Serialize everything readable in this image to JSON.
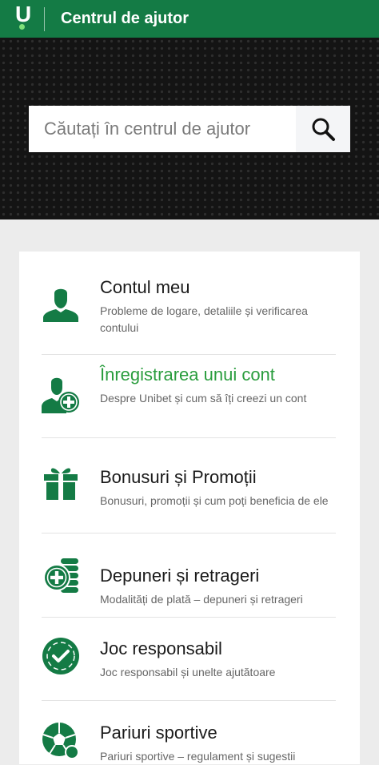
{
  "header": {
    "title": "Centrul de ajutor",
    "logo_letter": "U"
  },
  "search": {
    "placeholder": "Căutați în centrul de ajutor"
  },
  "colors": {
    "brand_green": "#147b45",
    "highlight_green": "#2a9d3e",
    "icon_green": "#147b45"
  },
  "categories": [
    {
      "title": "Contul meu",
      "description": "Probleme de logare, detaliile și verificarea contului",
      "icon": "user-icon",
      "highlighted": false
    },
    {
      "title": "Înregistrarea unui cont",
      "description": "Despre Unibet și cum să îți creezi un cont",
      "icon": "user-add-icon",
      "highlighted": true
    },
    {
      "title": "Bonusuri și Promoții",
      "description": "Bonusuri, promoții și cum poți beneficia de ele",
      "icon": "gift-icon",
      "highlighted": false
    },
    {
      "title": "Depuneri și retrageri",
      "description": "Modalități de plată – depuneri și retrageri",
      "icon": "coins-plus-icon",
      "highlighted": false
    },
    {
      "title": "Joc responsabil",
      "description": "Joc responsabil și unelte ajutătoare",
      "icon": "check-chip-icon",
      "highlighted": false
    },
    {
      "title": "Pariuri sportive",
      "description": "Pariuri sportive – regulament și sugestii",
      "icon": "soccer-ball-icon",
      "highlighted": false
    }
  ]
}
